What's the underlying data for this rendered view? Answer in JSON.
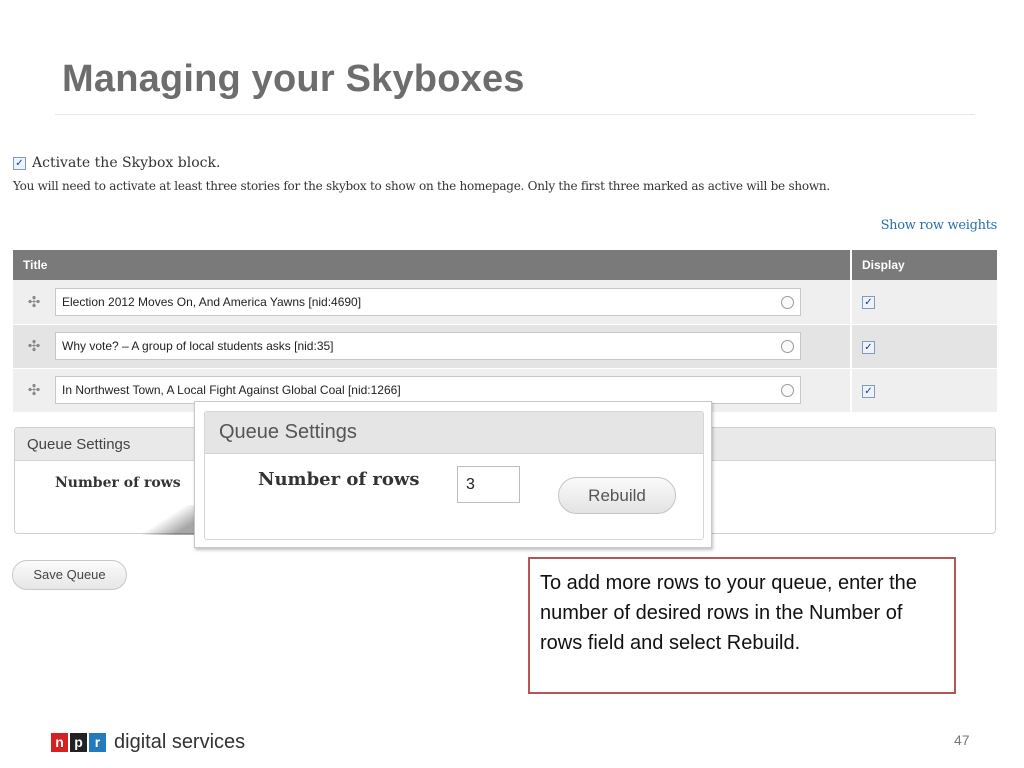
{
  "slide": {
    "title": "Managing your Skyboxes",
    "page_number": "47"
  },
  "activate": {
    "label": "Activate the Skybox block.",
    "checked": true,
    "help": "You will need to activate at least three stories for the skybox to show on the homepage. Only the first three marked as active will be shown."
  },
  "table": {
    "show_weights_link": "Show row weights",
    "headers": {
      "title": "Title",
      "display": "Display"
    },
    "rows": [
      {
        "title": "Election 2012 Moves On, And America Yawns [nid:4690]",
        "display": true
      },
      {
        "title": "Why vote? – A group of local students asks [nid:35]",
        "display": true
      },
      {
        "title": "In Northwest Town, A Local Fight Against Global Coal [nid:1266]",
        "display": true
      }
    ]
  },
  "queue_settings": {
    "heading": "Queue Settings",
    "rows_label": "Number of rows",
    "rows_value": "3",
    "rebuild_label": "Rebuild"
  },
  "save_queue_label": "Save Queue",
  "callout_text": "To add more rows to your queue, enter the number of desired rows in the Number of rows field and select Rebuild.",
  "logo": {
    "letters": [
      "n",
      "p",
      "r"
    ],
    "text": "digital services",
    "colors": [
      "#d62021",
      "#222222",
      "#237bbd"
    ]
  },
  "icons": {
    "drag": "✣",
    "check": "✓"
  }
}
